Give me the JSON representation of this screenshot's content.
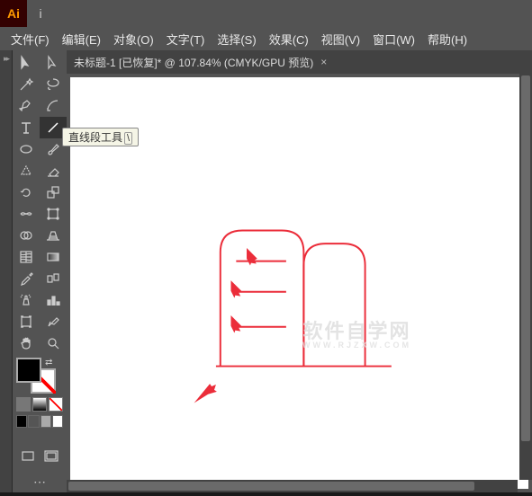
{
  "app": {
    "logo": "Ai",
    "info_tip": "i"
  },
  "menu": {
    "file": "文件(F)",
    "edit": "编辑(E)",
    "object": "对象(O)",
    "type": "文字(T)",
    "select": "选择(S)",
    "effect": "效果(C)",
    "view": "视图(V)",
    "window": "窗口(W)",
    "help": "帮助(H)"
  },
  "doc": {
    "tab_label": "未标题-1 [已恢复]* @ 107.84% (CMYK/GPU 预览)",
    "close_x": "×"
  },
  "tooltip": {
    "label": "直线段工具",
    "shortcut": "\\"
  },
  "watermark": {
    "main": "软件自学网",
    "sub": "WWW.RJZXW.COM"
  }
}
